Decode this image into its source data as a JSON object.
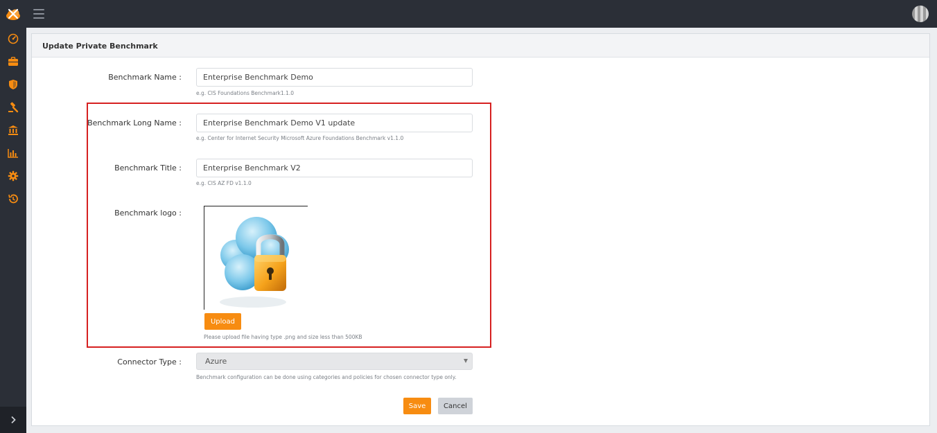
{
  "app": {
    "logo_icon": "cloud-logo-icon",
    "menu_icon": "hamburger-icon",
    "accent_color": "#f78c11",
    "sidebar_icons": [
      "dashboard-icon",
      "briefcase-icon",
      "shield-icon",
      "gavel-icon",
      "institution-icon",
      "bar-chart-icon",
      "gear-icon",
      "history-icon"
    ],
    "sidebar_expand_icon": "chevron-right-icon"
  },
  "panel": {
    "title": "Update Private Benchmark"
  },
  "form": {
    "name": {
      "label": "Benchmark Name :",
      "value": "Enterprise Benchmark Demo",
      "hint": "e.g. CIS Foundations Benchmark1.1.0"
    },
    "long_name": {
      "label": "Benchmark Long Name :",
      "value": "Enterprise Benchmark Demo V1 update",
      "hint": "e.g. Center for Internet Security Microsoft Azure Foundations Benchmark v1.1.0"
    },
    "title": {
      "label": "Benchmark Title :",
      "value": "Enterprise Benchmark V2",
      "hint": "e.g. CIS AZ FD v1.1.0"
    },
    "logo": {
      "label": "Benchmark logo :",
      "image_icon": "cloud-lock-icon",
      "upload_label": "Upload",
      "hint": "Please upload file having type .png and size less than 500KB"
    },
    "connector": {
      "label": "Connector Type :",
      "value": "Azure",
      "hint": "Benchmark configuration can be done using categories and policies for chosen connector type only."
    },
    "save_label": "Save",
    "cancel_label": "Cancel"
  }
}
